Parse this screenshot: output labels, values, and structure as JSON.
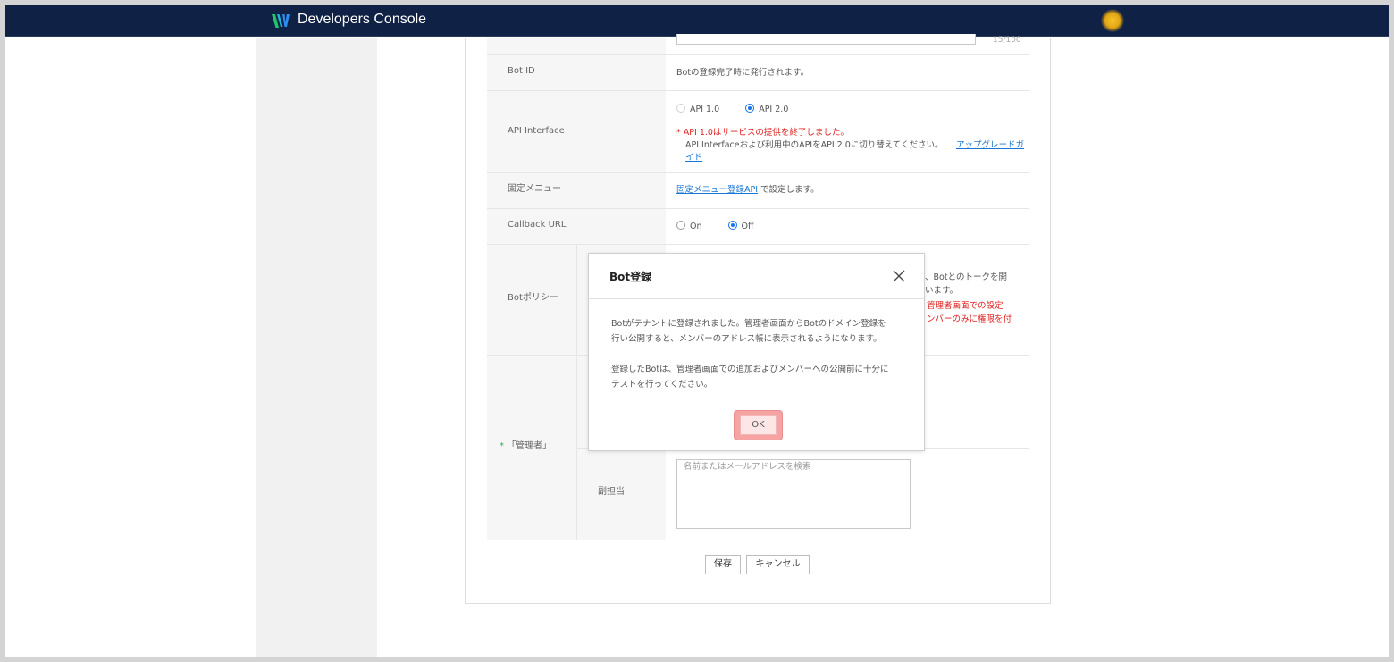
{
  "app": {
    "title": "Developers Console"
  },
  "form": {
    "counter": "15/100",
    "bot_id": {
      "label": "Bot ID",
      "value": "Botの登録完了時に発行されます。"
    },
    "api_interface": {
      "label": "API Interface",
      "options": [
        "API 1.0",
        "API 2.0"
      ],
      "selected": "API 2.0",
      "notice": "* API 1.0はサービスの提供を終了しました。",
      "note": "API Interfaceおよび利用中のAPIをAPI 2.0に切り替えてください。",
      "guide_link_line1": "アップグレードガ",
      "guide_link_line2": "イド"
    },
    "fixed_menu": {
      "label": "固定メニュー",
      "link": "固定メニュー登録API",
      "suffix": " で設定します。"
    },
    "callback": {
      "label": "Callback URL",
      "on": "On",
      "off": "Off",
      "selected": "Off"
    },
    "bot_policy": {
      "label": "Botポリシー",
      "partial_line1": "、Botとのトークを開",
      "partial_line2": "います。",
      "partial_red1": "管理者画面での設定",
      "partial_red2": "ンバーのみに権限を付"
    },
    "admin": {
      "label_star": "*",
      "label": "「管理者」",
      "sub_label": "副担当",
      "search_placeholder": "名前またはメールアドレスを検索"
    },
    "save_label": "保存",
    "cancel_label": "キャンセル"
  },
  "modal": {
    "title": "Bot登録",
    "paragraph1_line1": "Botがテナントに登録されました。管理者画面からBotのドメイン登録を",
    "paragraph1_line2": "行い公開すると、メンバーのアドレス帳に表示されるようになります。",
    "paragraph2_line1": "登録したBotは、管理者画面での追加およびメンバーへの公開前に十分に",
    "paragraph2_line2": "テストを行ってください。",
    "ok_label": "OK"
  },
  "colors": {
    "topbar": "#0f2145",
    "accent": "#1a73e8",
    "notice": "#e02020",
    "highlight": "#f6a3a3"
  },
  "icons": {
    "logo": "w-logo-icon",
    "close": "close-icon",
    "avatar": "user-avatar"
  }
}
